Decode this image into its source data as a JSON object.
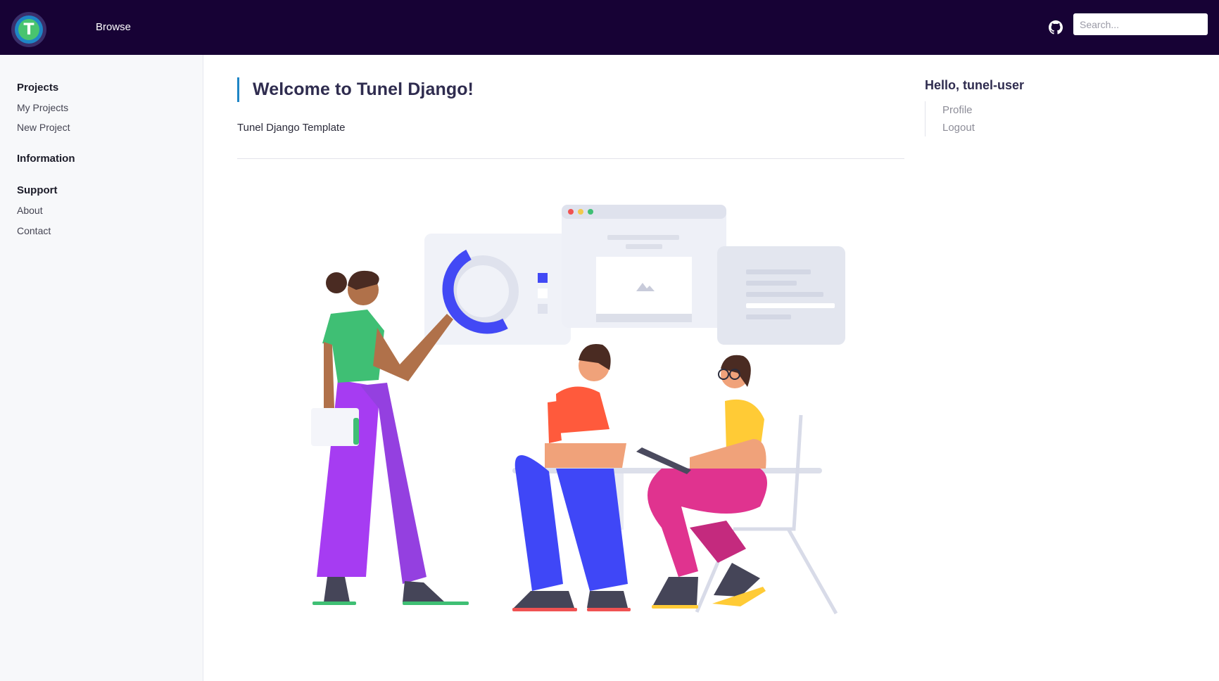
{
  "header": {
    "nav": {
      "browse_label": "Browse"
    },
    "logo_letter": "T",
    "github_icon": "github-icon",
    "search": {
      "placeholder": "Search...",
      "value": ""
    }
  },
  "sidebar": {
    "sections": [
      {
        "heading": "Projects",
        "links": [
          "My Projects",
          "New Project"
        ]
      },
      {
        "heading": "Information",
        "links": []
      },
      {
        "heading": "Support",
        "links": [
          "About",
          "Contact"
        ]
      }
    ]
  },
  "main": {
    "title": "Welcome to Tunel Django!",
    "subtitle": "Tunel Django Template"
  },
  "user_panel": {
    "greeting": "Hello, tunel-user",
    "links": [
      "Profile",
      "Logout"
    ]
  },
  "colors": {
    "topbar": "#170235",
    "accent": "#1f86c6",
    "sidebar_bg": "#f7f8fa"
  }
}
